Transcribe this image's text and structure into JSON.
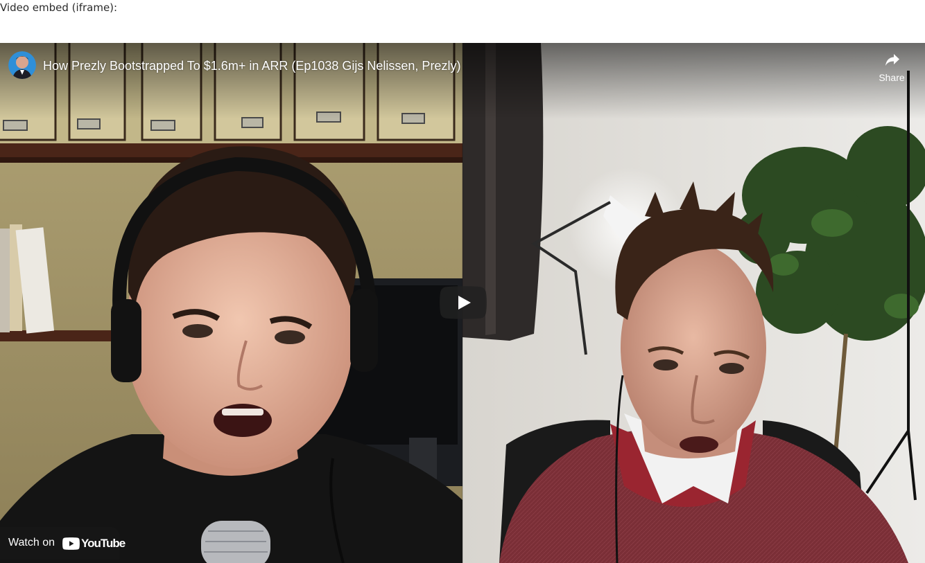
{
  "page": {
    "label": "Video embed (iframe):"
  },
  "video": {
    "title": "How Prezly Bootstrapped To $1.6m+ in ARR (Ep1038 Gijs Nelissen, Prezly)",
    "share_label": "Share",
    "watch_on_label": "Watch on",
    "platform_wordmark": "YouTube",
    "icons": {
      "share": "share-arrow-icon",
      "play": "play-icon",
      "logo": "youtube-logo"
    },
    "colors": {
      "play_button_bg": "#212121",
      "youtube_red": "#ff0000",
      "sweater": "#7a2e36",
      "shirt_left": "#151515",
      "wall_left": "#a99a6c",
      "wall_right": "#e6e3de"
    }
  }
}
